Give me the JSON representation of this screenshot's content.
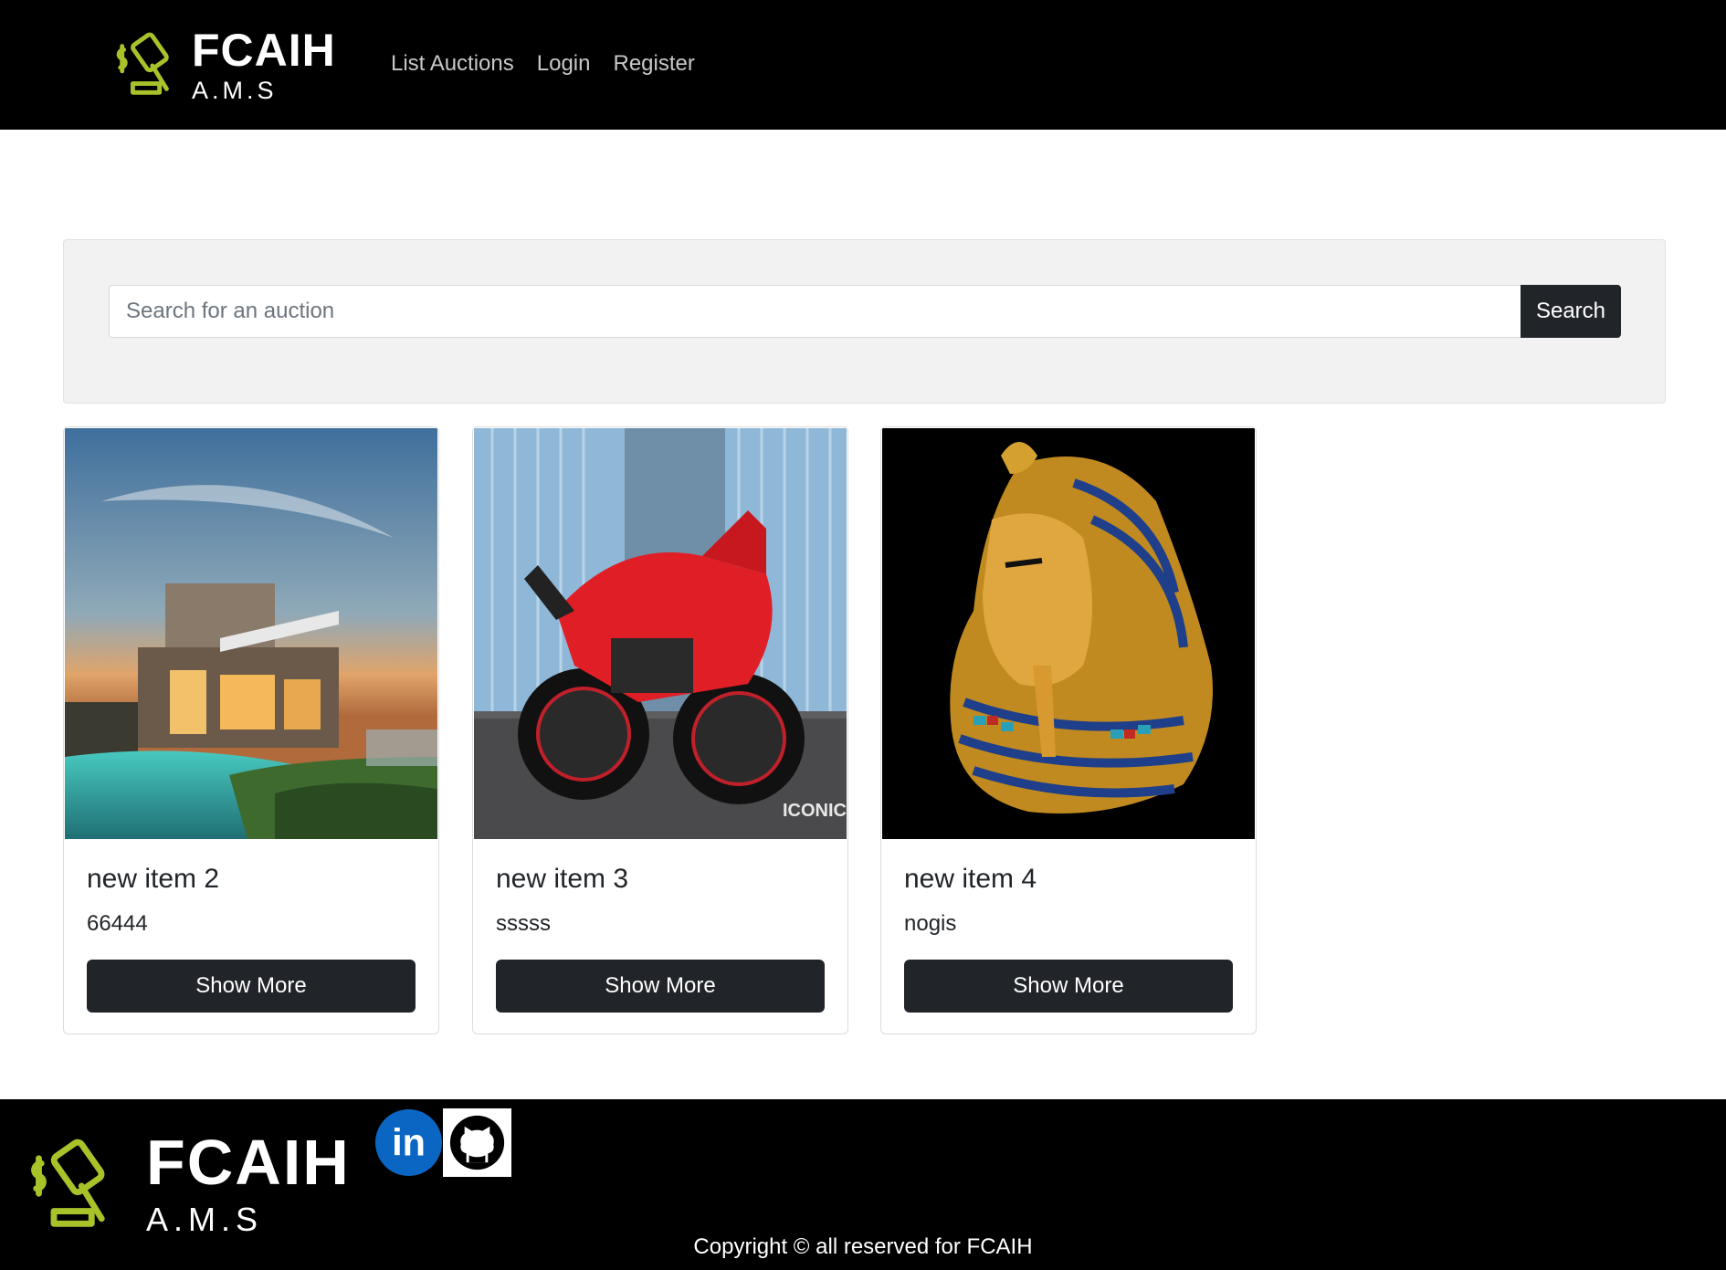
{
  "header": {
    "brand_title": "FCAIH",
    "brand_subtitle": "A.M.S",
    "nav": [
      {
        "label": "List Auctions"
      },
      {
        "label": "Login"
      },
      {
        "label": "Register"
      }
    ]
  },
  "search": {
    "placeholder": "Search for an auction",
    "value": "",
    "button_label": "Search"
  },
  "cards": [
    {
      "title": "new item 2",
      "description": "66444",
      "button_label": "Show More",
      "image": "modern-house-photo"
    },
    {
      "title": "new item 3",
      "description": "sssss",
      "button_label": "Show More",
      "image": "red-motorcycle-photo",
      "image_caption": "ICONIC MOTORBIKES"
    },
    {
      "title": "new item 4",
      "description": "nogis",
      "button_label": "Show More",
      "image": "pharaoh-mask-photo"
    }
  ],
  "footer": {
    "brand_title": "FCAIH",
    "brand_subtitle": "A.M.S",
    "social": [
      {
        "icon": "linkedin-icon",
        "label": "in"
      },
      {
        "icon": "github-icon"
      }
    ],
    "copyright": "Copyright © all reserved for FCAIH"
  },
  "colors": {
    "header_bg": "#000000",
    "logo_green": "#a8c32a",
    "button_dark": "#212529",
    "linkedin_blue": "#0a66c2"
  }
}
